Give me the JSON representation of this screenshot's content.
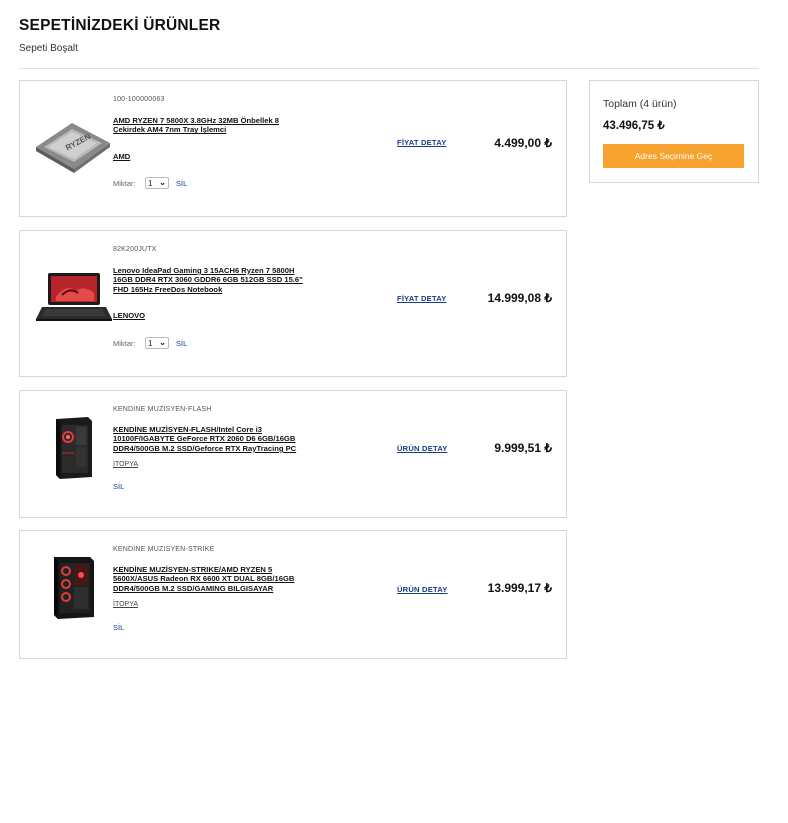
{
  "header": {
    "title": "SEPETİNİZDEKİ ÜRÜNLER",
    "empty_cart": "Sepeti Boşalt"
  },
  "items": [
    {
      "sku": "100-100000063",
      "name": "AMD RYZEN 7 5800X 3.8GHz 32MB Önbellek 8 Çekirdek AM4 7nm Tray İşlemci",
      "brand": "AMD",
      "qty_label": "Miktar:",
      "qty_value": "1",
      "remove": "SİL",
      "detail": "FİYAT DETAY",
      "price": "4.499,00 ₺",
      "image_icon": "cpu-chip-icon"
    },
    {
      "sku": "82K200JUTX",
      "name": "Lenovo IdeaPad Gaming 3 15ACH6 Ryzen 7 5800H 16GB DDR4 RTX 3060 GDDR6 6GB 512GB SSD 15.6\" FHD 165Hz FreeDos Notebook",
      "brand": "LENOVO",
      "qty_label": "Miktar:",
      "qty_value": "1",
      "remove": "SİL",
      "detail": "FİYAT DETAY",
      "price": "14.999,08 ₺",
      "image_icon": "laptop-icon"
    },
    {
      "sku": "KENDINE MUZISYEN-FLASH",
      "name": "KENDİNE MUZİSYEN-FLASH/Intel Core i3 10100F/IGABYTE GeForce RTX 2060 D6 6GB/16GB DDR4/500GB M.2 SSD/Geforce RTX RayTracing PC",
      "brand": "İTOPYA",
      "remove": "SİL",
      "detail": "ÜRÜN DETAY",
      "price": "9.999,51 ₺",
      "image_icon": "pc-case-icon"
    },
    {
      "sku": "KENDINE MUZISYEN-STRIKE",
      "name": "KENDİNE MUZİSYEN-STRIKE/AMD RYZEN 5 5600X/ASUS Radeon RX 6600 XT DUAL 8GB/16GB DDR4/500GB M.2 SSD/GAMING BILGISAYAR",
      "brand": "İTOPYA",
      "remove": "SİL",
      "detail": "ÜRÜN DETAY",
      "price": "13.999,17 ₺",
      "image_icon": "pc-case-icon"
    }
  ],
  "summary": {
    "total_label": "Toplam (4 ürün)",
    "total_value": "43.496,75 ₺",
    "checkout_button": "Adres Seçimine Geç"
  },
  "colors": {
    "accent": "#f7a12e",
    "link": "#1a3a8a",
    "border": "#d6d6d6"
  }
}
